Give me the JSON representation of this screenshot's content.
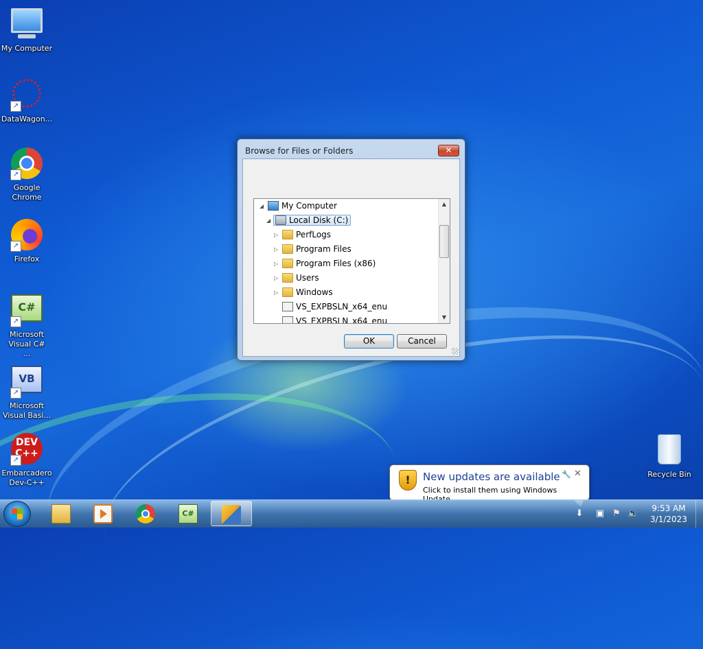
{
  "desktop": {
    "icons": [
      {
        "label": "My Computer"
      },
      {
        "label": "DataWagon..."
      },
      {
        "label": "Google Chrome"
      },
      {
        "label": "Firefox"
      },
      {
        "label": "Microsoft Visual C# ..."
      },
      {
        "label": "Microsoft Visual Basi..."
      },
      {
        "label": "Embarcadero Dev-C++"
      },
      {
        "label": "Recycle Bin"
      }
    ]
  },
  "dialog": {
    "title": "Browse for Files or Folders",
    "close_glyph": "✕",
    "tree": [
      {
        "label": "My Computer",
        "expanded": true
      },
      {
        "label": "Local Disk (C:)",
        "expanded": true,
        "selected": true
      },
      {
        "label": "PerfLogs"
      },
      {
        "label": "Program Files"
      },
      {
        "label": "Program Files (x86)"
      },
      {
        "label": "Users"
      },
      {
        "label": "Windows"
      },
      {
        "label": "VS_EXPBSLN_x64_enu"
      },
      {
        "label": "VS_EXPBSLN_x64_enu"
      }
    ],
    "ok_label": "OK",
    "cancel_label": "Cancel"
  },
  "notification": {
    "title": "New updates are available",
    "text": "Click to install them using Windows Update."
  },
  "taskbar": {
    "pinned": [
      "windows-explorer",
      "media-player",
      "google-chrome",
      "visual-csharp",
      "setup-program"
    ],
    "active": "setup-program"
  },
  "clock": {
    "time": "9:53 AM",
    "date": "3/1/2023"
  },
  "colors": {
    "desktop_blue": "#1769db",
    "balloon_title": "#1c3f94"
  }
}
